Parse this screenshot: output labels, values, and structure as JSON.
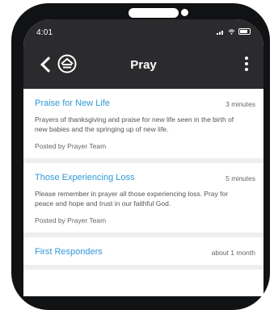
{
  "status": {
    "time": "4:01"
  },
  "header": {
    "title": "Pray"
  },
  "items": [
    {
      "title": "Praise for New Life",
      "time": "3 minutes",
      "body": "Prayers of thanksgiving and praise for new life seen in the birth of new babies and the springing up of new life.",
      "posted": "Posted by Prayer Team"
    },
    {
      "title": "Those Experiencing Loss",
      "time": "5 minutes",
      "body": "Please remember in prayer all those experiencing loss. Pray for peace and hope and trust in our faithful God.",
      "posted": "Posted by Prayer Team"
    },
    {
      "title": "First Responders",
      "time": "about 1 month",
      "body": "",
      "posted": ""
    }
  ],
  "colors": {
    "accent": "#2f9ad6",
    "header": "#2b2b2d",
    "divider": "#eeeeee"
  },
  "icons": [
    "back-chevron-icon",
    "church-logo-icon",
    "more-vertical-icon",
    "wifi-icon",
    "signal-icon",
    "battery-icon"
  ]
}
